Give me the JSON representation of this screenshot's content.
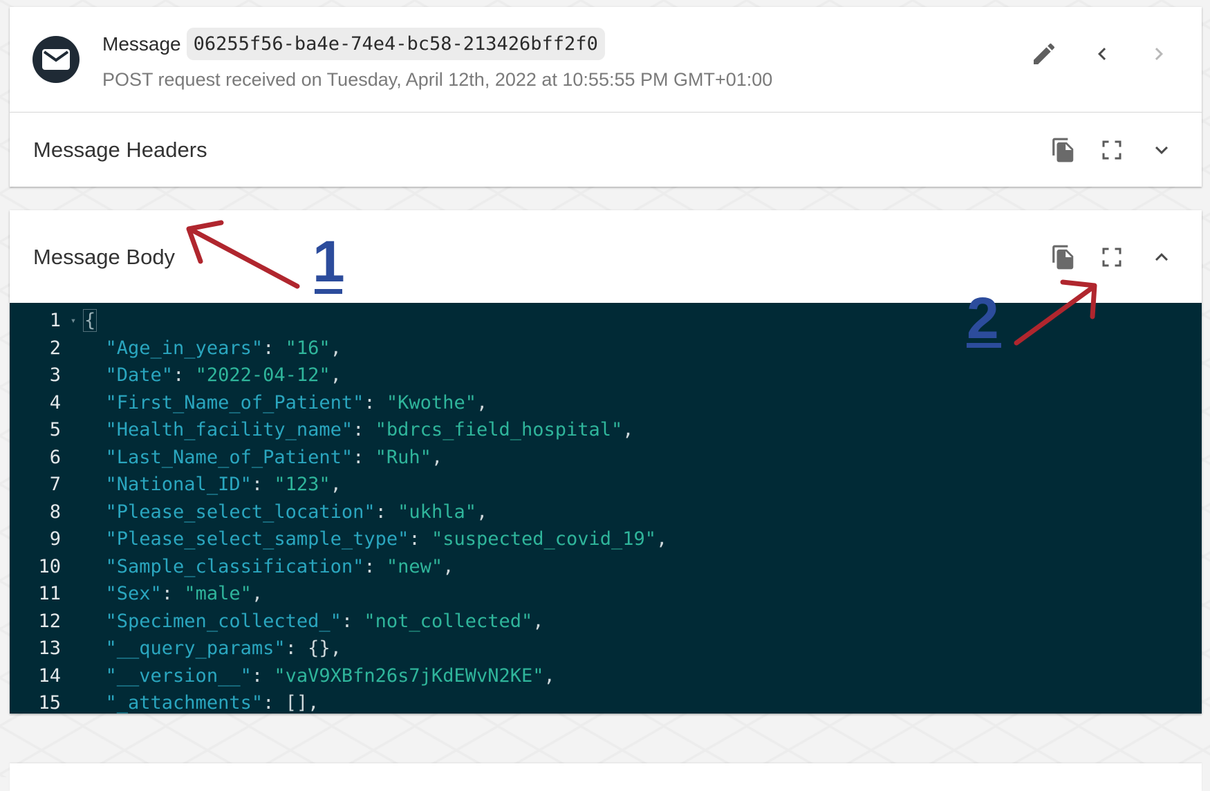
{
  "message": {
    "label": "Message",
    "id": "06255f56-ba4e-74e4-bc58-213426bff2f0",
    "subtitle": "POST request received on Tuesday, April 12th, 2022 at 10:55:55 PM GMT+01:00"
  },
  "headers_panel": {
    "title": "Message Headers"
  },
  "body_panel": {
    "title": "Message Body",
    "lines": [
      {
        "n": "1",
        "open": "{"
      },
      {
        "n": "2",
        "key": "\"Age_in_years\"",
        "sep": ": ",
        "val": "\"16\"",
        "end": ","
      },
      {
        "n": "3",
        "key": "\"Date\"",
        "sep": ": ",
        "val": "\"2022-04-12\"",
        "end": ","
      },
      {
        "n": "4",
        "key": "\"First_Name_of_Patient\"",
        "sep": ": ",
        "val": "\"Kwothe\"",
        "end": ","
      },
      {
        "n": "5",
        "key": "\"Health_facility_name\"",
        "sep": ": ",
        "val": "\"bdrcs_field_hospital\"",
        "end": ","
      },
      {
        "n": "6",
        "key": "\"Last_Name_of_Patient\"",
        "sep": ": ",
        "val": "\"Ruh\"",
        "end": ","
      },
      {
        "n": "7",
        "key": "\"National_ID\"",
        "sep": ": ",
        "val": "\"123\"",
        "end": ","
      },
      {
        "n": "8",
        "key": "\"Please_select_location\"",
        "sep": ": ",
        "val": "\"ukhla\"",
        "end": ","
      },
      {
        "n": "9",
        "key": "\"Please_select_sample_type\"",
        "sep": ": ",
        "val": "\"suspected_covid_19\"",
        "end": ","
      },
      {
        "n": "10",
        "key": "\"Sample_classification\"",
        "sep": ": ",
        "val": "\"new\"",
        "end": ","
      },
      {
        "n": "11",
        "key": "\"Sex\"",
        "sep": ": ",
        "val": "\"male\"",
        "end": ","
      },
      {
        "n": "12",
        "key": "\"Specimen_collected_\"",
        "sep": ": ",
        "val": "\"not_collected\"",
        "end": ","
      },
      {
        "n": "13",
        "key": "\"__query_params\"",
        "sep": ": ",
        "plain": "{}",
        "end": ","
      },
      {
        "n": "14",
        "key": "\"__version__\"",
        "sep": ": ",
        "val": "\"vaV9XBfn26s7jKdEWvN2KE\"",
        "end": ","
      },
      {
        "n": "15",
        "key": "\"_attachments\"",
        "sep": ": ",
        "plain": "[]",
        "end": ","
      }
    ]
  },
  "annotations": {
    "one": "1",
    "two": "2"
  },
  "icons": {
    "avatar": "mail-icon",
    "edit": "pencil-icon",
    "prev": "chevron-left-icon",
    "next": "chevron-right-icon",
    "copy": "copy-icon",
    "fullscreen": "fullscreen-icon",
    "expand": "chevron-down-icon",
    "collapse": "chevron-up-icon"
  },
  "colors": {
    "editor_bg": "#012a36",
    "json_key": "#2aa6bf",
    "json_string": "#2fb59b",
    "annotation_arrow": "#b0262e",
    "annotation_number": "#2c4c9c"
  }
}
